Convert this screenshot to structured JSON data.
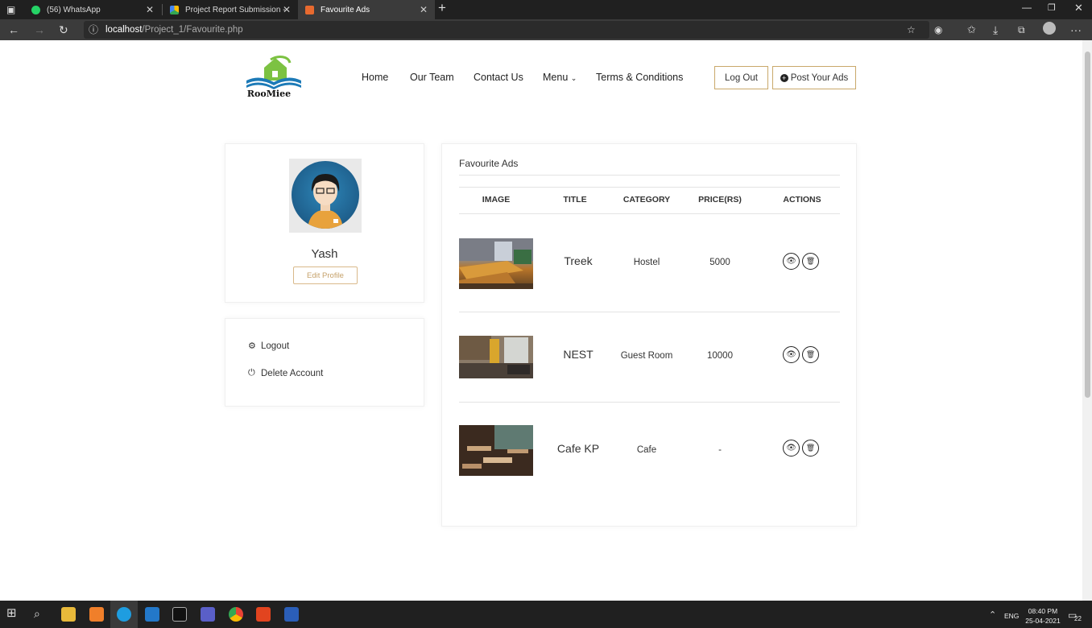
{
  "browser": {
    "tabs": [
      {
        "title": "(56) WhatsApp"
      },
      {
        "title": "Project Report Submission - Goo"
      },
      {
        "title": "Favourite Ads"
      }
    ],
    "url_host": "localhost",
    "url_path": "/Project_1/Favourite.php",
    "icons": [
      "tab-actions-icon",
      "new-tab-icon",
      "minimize-icon",
      "restore-icon",
      "close-icon",
      "back-icon",
      "forward-icon",
      "refresh-icon",
      "info-icon",
      "add-favorite-icon",
      "extension-icon",
      "favorites-icon",
      "downloads-icon",
      "collections-icon",
      "profile-icon",
      "more-icon"
    ]
  },
  "site": {
    "brand": "RooMiee",
    "nav": [
      "Home",
      "Our Team",
      "Contact Us",
      "Menu",
      "Terms & Conditions"
    ],
    "logout_label": "Log Out",
    "post_ads_label": "Post Your Ads"
  },
  "profile": {
    "name": "Yash",
    "edit_label": "Edit Profile"
  },
  "side_menu": [
    {
      "label": "Logout",
      "icon": "gear-icon"
    },
    {
      "label": "Delete Account",
      "icon": "power-icon"
    }
  ],
  "favourites": {
    "title": "Favourite Ads",
    "columns": [
      "IMAGE",
      "TITLE",
      "CATEGORY",
      "PRICE(RS)",
      "ACTIONS"
    ],
    "rows": [
      {
        "title": "Treek",
        "category": "Hostel",
        "price": "5000"
      },
      {
        "title": "NEST",
        "category": "Guest Room",
        "price": "10000"
      },
      {
        "title": "Cafe KP",
        "category": "Cafe",
        "price": "-"
      }
    ]
  },
  "taskbar": {
    "lang": "ENG",
    "time": "08:40 PM",
    "date": "25-04-2021",
    "notifications": "22"
  }
}
